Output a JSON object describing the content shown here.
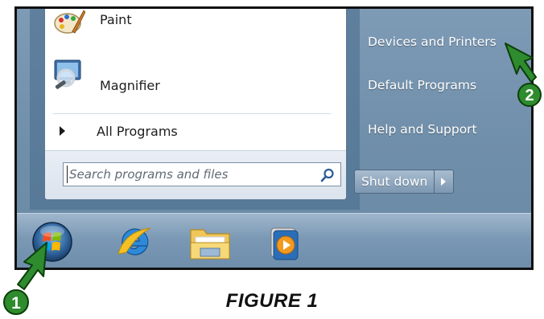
{
  "start_menu": {
    "programs": [
      {
        "label": "Paint",
        "icon": "paint-icon"
      },
      {
        "label": "Magnifier",
        "icon": "magnifier-icon"
      }
    ],
    "all_programs_label": "All Programs",
    "search": {
      "placeholder": "Search programs and files",
      "value": "",
      "icon": "search-icon"
    },
    "right_items": [
      {
        "label": "Devices and Printers"
      },
      {
        "label": "Default Programs"
      },
      {
        "label": "Help and Support"
      }
    ],
    "shutdown": {
      "label": "Shut down",
      "arrow_icon": "triangle-right-icon"
    }
  },
  "taskbar": {
    "items": [
      {
        "icon": "windows-start-orb-icon"
      },
      {
        "icon": "internet-explorer-icon"
      },
      {
        "icon": "windows-explorer-folder-icon"
      },
      {
        "icon": "media-player-icon"
      }
    ]
  },
  "callouts": [
    {
      "number": "1",
      "color": "#2e8b2e"
    },
    {
      "number": "2",
      "color": "#2e8b2e"
    }
  ],
  "caption": "FIGURE 1"
}
